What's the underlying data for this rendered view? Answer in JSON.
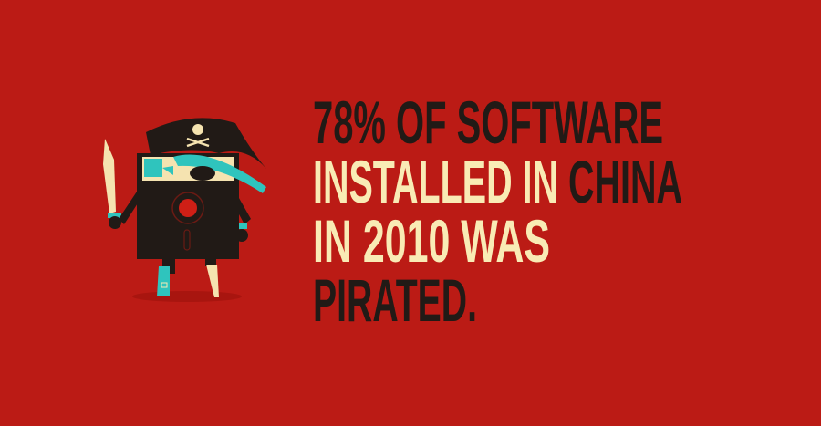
{
  "headline": {
    "line1": "78% OF SOFTWARE",
    "line2_part1": "INSTALLED IN ",
    "line2_part2": "CHINA",
    "line3": "IN 2010 WAS",
    "line4": "PIRATED."
  },
  "colors": {
    "background": "#bb1b15",
    "dark_text": "#211a16",
    "cream_text": "#f9ebb5",
    "teal": "#2fc4bd"
  },
  "illustration": {
    "icon": "pirate-floppy-disk-icon"
  }
}
